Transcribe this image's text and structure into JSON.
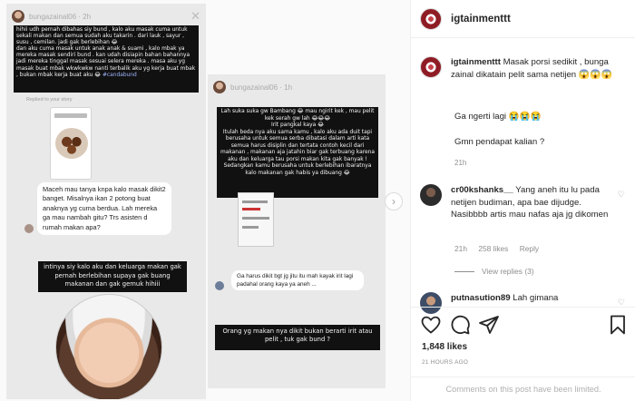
{
  "story_left": {
    "user": "bungazainal06 · 2h",
    "close": "✕",
    "black_text": "hihii udh pernah dibahas siy bund , kalo aku masak cuma untuk sekali makan dan semua sudah aku takarin . dari lauk , sayur , susu , cemilan. jadi gak berlebihan 😂\ndan aku cuma masak untuk anak anak & suami , kalo mbak ya mereka masak sendiri bund . kan udah disiapin bahan bahannya jadi mereka tinggal masak sesuai selera mereka . masa aku yg masak buat mbak wkwkwkw nanti terbalik aku yg kerja buat mbak , bukan mbak kerja buat aku 😂 ",
    "tag": "#candabund",
    "reply_label": "Replied to your story",
    "bubble": "Maceh mau tanya knpa kalo masak dikit2 banget. Misalnya ikan 2 potong buat anaknya yg cuma berdua. Lah mereka ga mau nambah gitu? Trs asisten d rumah makan apa?",
    "black_text2": "intinya siy kalo aku dan keluarga makan gak pernah berlebihan supaya gak buang makanan dan gak gemuk hihiii"
  },
  "story_right": {
    "user": "bungazainal06 · 1h",
    "black_text": "Lah suka suka gw Bambang 😂 mau ngirit kek , mau pelit kek serah gw lah 😂😂😂\nIrit pangkal kaya 😂\nItulah beda nya aku sama kamu , kalo aku ada duit tapi berusaha untuk semua serba dibatasi dalam arti kata semua harus disiplin dan tertata contoh kecil dari makanan , makanan aja jatahin biar gak terbuang karena aku dan keluarga tau porsi makan kita gak banyak ! Sedangkan kamu berusaha untuk berlebihan ibaratnya kalo makanan gak habis ya dibuang 😂",
    "bubble": "Ga harus dikit bgt jg jitu itu mah kayak irit lagi padahal orang kaya ya aneh ...",
    "black_text2": "Orang yg makan nya dikit bukan berarti irit atau pelit , tuk gak bund ?"
  },
  "media_nav": {
    "next_icon": "›"
  },
  "panel": {
    "header_user": "igtainmenttt",
    "caption_user": "igtainmenttt",
    "caption_text": " Masak porsi sedikit , bunga zainal dikatain pelit sama netijen ",
    "caption_emojis": "😱😱😱",
    "caption_line2": "Ga ngerti lagi 😭😭😭",
    "caption_line3": "Gmn pendapat kalian ?",
    "caption_time": "21h",
    "comments": [
      {
        "user": "cr00kshanks__",
        "text": " Yang aneh itu lu pada netijen budiman, apa bae dijudge. Nasibbbb artis mau nafas aja jg dikomen",
        "time": "21h",
        "likes": "258 likes",
        "reply": "Reply",
        "view_replies": "View replies (3)"
      },
      {
        "user": "putnasution89",
        "text": " Lah gimana"
      }
    ],
    "likes": "1,848 likes",
    "post_time": "21 HOURS AGO",
    "footer": "Comments on this post have been limited."
  }
}
